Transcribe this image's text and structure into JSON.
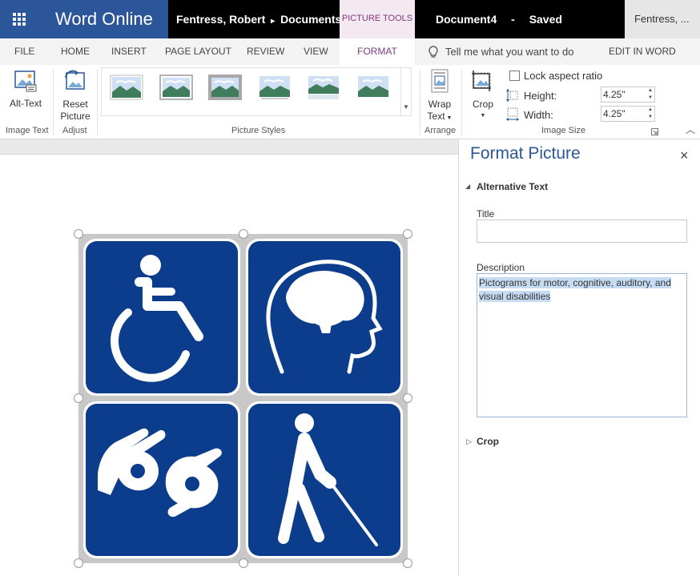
{
  "titlebar": {
    "app_name": "Word Online",
    "breadcrumb_user": "Fentress, Robert",
    "breadcrumb_sep": "▸",
    "breadcrumb_folder": "Documents",
    "context_tools": "PICTURE TOOLS",
    "doc_name": "Document4",
    "doc_sep": "-",
    "doc_status": "Saved",
    "user": "Fentress, ..."
  },
  "tabs": {
    "file": "FILE",
    "home": "HOME",
    "insert": "INSERT",
    "page_layout": "PAGE LAYOUT",
    "review": "REVIEW",
    "view": "VIEW",
    "format": "FORMAT",
    "tell_me": "Tell me what you want to do",
    "edit_in_word": "EDIT IN WORD"
  },
  "ribbon": {
    "alt_text": "Alt-Text",
    "group_image_text": "Image Text",
    "reset_line1": "Reset",
    "reset_line2": "Picture",
    "group_adjust": "Adjust",
    "group_picture_styles": "Picture Styles",
    "wrap_line1": "Wrap",
    "wrap_line2": "Text",
    "group_arrange": "Arrange",
    "crop": "Crop",
    "lock_aspect": "Lock aspect ratio",
    "height_label": "Height:",
    "height_value": "4.25\"",
    "width_label": "Width:",
    "width_value": "4.25\"",
    "group_image_size": "Image Size"
  },
  "pane": {
    "title": "Format Picture",
    "close_glyph": "×",
    "section_alt": "Alternative Text",
    "title_label": "Title",
    "title_value": "",
    "description_label": "Description",
    "description_value": "Pictograms for motor, cognitive, auditory, and visual disabilities",
    "section_crop": "Crop"
  },
  "colors": {
    "brand": "#2b579a",
    "picture_tools": "#80397b",
    "tile": "#0b3d8c"
  }
}
